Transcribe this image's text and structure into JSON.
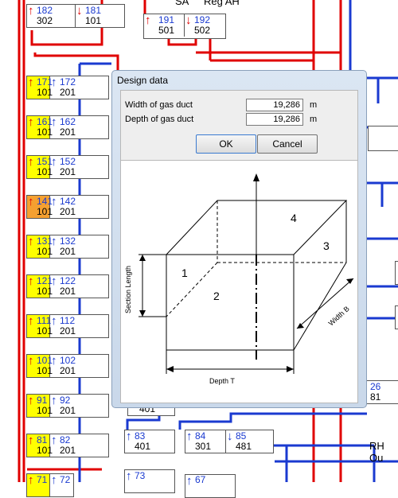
{
  "header": {
    "label_sa": "SA",
    "label_reg_ah": "Reg AH",
    "label_rh_out": "RH Ou"
  },
  "top_nodes": [
    {
      "left": {
        "top": "182",
        "bottom": "302",
        "dir": "up",
        "color": "red"
      },
      "right": {
        "top": "181",
        "bottom": "101",
        "dir": "down",
        "color": "red"
      }
    },
    {
      "left": {
        "top": "191",
        "bottom": "501",
        "dir": "up",
        "color": "red"
      },
      "right": {
        "top": "192",
        "bottom": "502",
        "dir": "down",
        "color": "red"
      }
    }
  ],
  "left_column": [
    {
      "left": {
        "top": "171",
        "bottom": "101"
      },
      "right": {
        "top": "172",
        "bottom": "201"
      }
    },
    {
      "left": {
        "top": "161",
        "bottom": "101"
      },
      "right": {
        "top": "162",
        "bottom": "201"
      }
    },
    {
      "left": {
        "top": "151",
        "bottom": "101"
      },
      "right": {
        "top": "152",
        "bottom": "201"
      }
    },
    {
      "left": {
        "top": "141",
        "bottom": "101"
      },
      "right": {
        "top": "142",
        "bottom": "201"
      }
    },
    {
      "left": {
        "top": "131",
        "bottom": "101"
      },
      "right": {
        "top": "132",
        "bottom": "201"
      }
    },
    {
      "left": {
        "top": "121",
        "bottom": "101"
      },
      "right": {
        "top": "122",
        "bottom": "201"
      }
    },
    {
      "left": {
        "top": "111",
        "bottom": "101"
      },
      "right": {
        "top": "112",
        "bottom": "201"
      }
    },
    {
      "left": {
        "top": "101",
        "bottom": "101"
      },
      "right": {
        "top": "102",
        "bottom": "201"
      }
    },
    {
      "left": {
        "top": "91",
        "bottom": "101"
      },
      "right": {
        "top": "92",
        "bottom": "201"
      }
    },
    {
      "left": {
        "top": "81",
        "bottom": "101"
      },
      "right": {
        "top": "82",
        "bottom": "201"
      }
    },
    {
      "left": {
        "top": "71",
        "bottom": ""
      },
      "right": {
        "top": "72",
        "bottom": ""
      }
    }
  ],
  "bottom_nodes": [
    {
      "label": "83",
      "value": "401"
    },
    {
      "label": "84",
      "value": "301"
    },
    {
      "label": "85",
      "value": "481"
    },
    {
      "label": "73",
      "value": ""
    },
    {
      "label": "67",
      "value": ""
    }
  ],
  "partial_nodes": {
    "under_dialog_value": "401",
    "right_node_top": "26",
    "right_node_bottom": "81"
  },
  "dialog": {
    "title": "Design data",
    "fields": [
      {
        "label": "Width of gas duct",
        "value": "19,286",
        "unit": "m"
      },
      {
        "label": "Depth of gas duct",
        "value": "19,286",
        "unit": "m"
      }
    ],
    "ok_label": "OK",
    "cancel_label": "Cancel",
    "drawing": {
      "face_labels": [
        "1",
        "2",
        "3",
        "4"
      ],
      "section_length_label": "Section Length",
      "width_label": "Width B",
      "depth_label": "Depth T"
    }
  },
  "colors": {
    "red_line": "#e00000",
    "blue_line": "#1a3ad0",
    "yellow": "#ffff00",
    "orange": "#f5a030"
  },
  "highlighted_node": "141"
}
